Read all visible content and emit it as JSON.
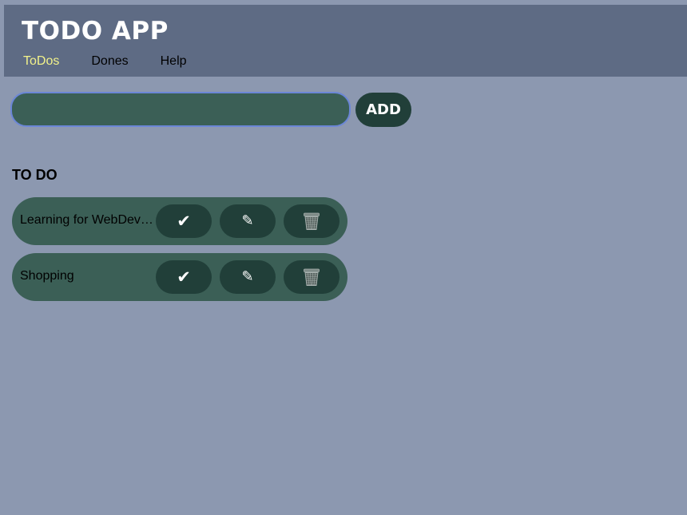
{
  "header": {
    "title": "TODO APP",
    "nav": [
      {
        "label": "ToDos",
        "active": true
      },
      {
        "label": "Dones",
        "active": false
      },
      {
        "label": "Help",
        "active": false
      }
    ]
  },
  "add_form": {
    "input_value": "",
    "add_label": "ADD"
  },
  "todo_section": {
    "title": "TO DO",
    "items": [
      {
        "text": "Learning for WebDevelopment"
      },
      {
        "text": "Shopping"
      }
    ]
  },
  "icons": {
    "done": "check-icon",
    "edit": "pencil-icon",
    "delete": "trash-icon"
  },
  "colors": {
    "page_background": "#8c98b0",
    "header_background": "#5e6b84",
    "active_nav": "#f2f28a",
    "item_background": "#3b5f56",
    "button_background": "#213f39",
    "input_border": "#6b86d6"
  }
}
